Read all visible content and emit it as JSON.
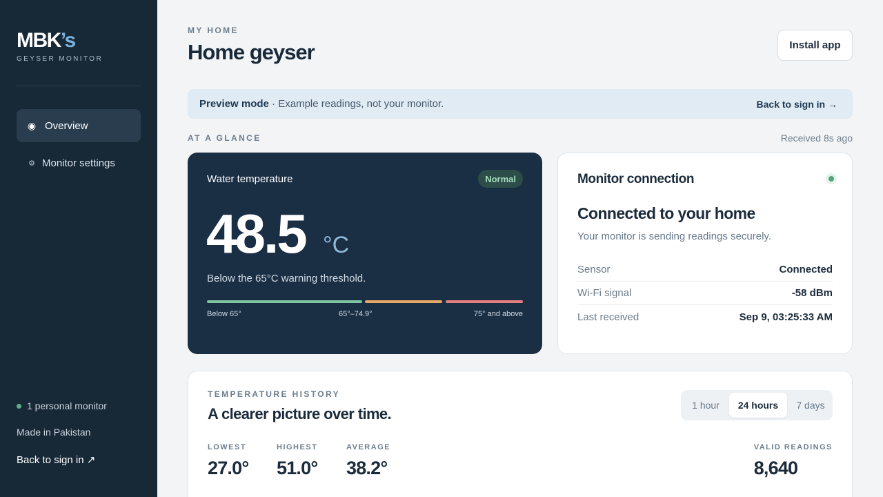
{
  "brand": {
    "name_main": "MBK",
    "name_accent": "’s",
    "subtitle": "GEYSER MONITOR"
  },
  "sidebar": {
    "items": [
      {
        "label": "Overview",
        "icon": "radio-dot-icon",
        "active": true
      },
      {
        "label": "Monitor settings",
        "icon": "gear-icon",
        "active": false
      }
    ],
    "footer": {
      "monitor_count": "1 personal monitor",
      "made_in": "Made in Pakistan",
      "back_link": "Back to sign in ↗"
    }
  },
  "header": {
    "eyebrow": "MY HOME",
    "title": "Home geyser",
    "install_label": "Install app"
  },
  "banner": {
    "bold": "Preview mode",
    "text": " · Example readings, not your monitor.",
    "link": "Back to sign in →"
  },
  "glance": {
    "label": "AT A GLANCE",
    "received": "Received 8s ago"
  },
  "temperature": {
    "label": "Water temperature",
    "status": "Normal",
    "value": "48.5",
    "unit": "°C",
    "note": "Below the 65°C warning threshold.",
    "scale": [
      {
        "label": "Below 65°",
        "color": "#7fc39f"
      },
      {
        "label": "65°–74.9°",
        "color": "#e6a866"
      },
      {
        "label": "75° and above",
        "color": "#e57f7f"
      }
    ]
  },
  "connection": {
    "title": "Monitor connection",
    "headline": "Connected to your home",
    "subtitle": "Your monitor is sending readings securely.",
    "rows": [
      {
        "key": "Sensor",
        "value": "Connected"
      },
      {
        "key": "Wi-Fi signal",
        "value": "-58 dBm"
      },
      {
        "key": "Last received",
        "value": "Sep 9, 03:25:33 AM"
      }
    ],
    "status_color": "#4ea77b"
  },
  "history": {
    "eyebrow": "TEMPERATURE HISTORY",
    "title": "A clearer picture over time.",
    "ranges": [
      "1 hour",
      "24 hours",
      "7 days"
    ],
    "selected_range": "24 hours",
    "stats": [
      {
        "label": "LOWEST",
        "value": "27.0°"
      },
      {
        "label": "HIGHEST",
        "value": "51.0°"
      },
      {
        "label": "AVERAGE",
        "value": "38.2°"
      },
      {
        "label": "VALID READINGS",
        "value": "8,640"
      }
    ]
  }
}
